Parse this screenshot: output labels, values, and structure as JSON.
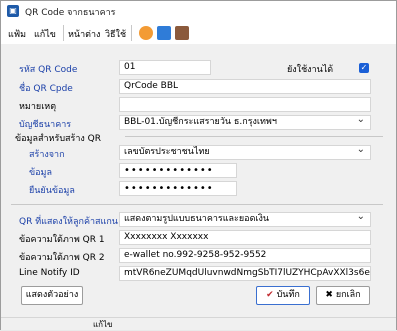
{
  "window": {
    "title": "QR Code จากธนาคาร",
    "icon": "qr-app-icon"
  },
  "menu": {
    "file": "แฟ้ม",
    "edit": "แก้ไข",
    "window": "หน้าต่าง",
    "method": "วิธีใช้"
  },
  "form": {
    "qr_code_label": "รหัส QR Code",
    "qr_code_value": "01",
    "inactive_label": "ยังใช้งานได้",
    "qr_name_label": "ชื่อ QR Cpde",
    "qr_name_value": "QrCode BBL",
    "note_label": "หมายเหตุ",
    "note_value": "",
    "bank_account_label": "บัญชีธนาคาร",
    "bank_account_value": "BBL-01.บัญชีกระแสรายวัน ธ.กรุงเทพฯ",
    "group_title": "ข้อมูลสำหรับสร้าง QR",
    "create_from_label": "สร้างจาก",
    "create_from_value": "เลขบัตรประชาชนไทย",
    "data_label": "ข้อมูล",
    "data_value": "•••••••••••••",
    "confirm_label": "ยืนยันข้อมูล",
    "confirm_value": "•••••••••••••",
    "qr_display_label": "QR ที่แสดงให้ลูกค้าสแกน",
    "qr_display_value": "แสดงตามรูปแบบธนาคารและยอดเงิน",
    "caption1_label": "ข้อความใต้ภาพ QR 1",
    "caption1_value": "Xxxxxxxx Xxxxxxx",
    "caption2_label": "ข้อความใต้ภาพ QR 2",
    "caption2_value": "e-wallet no.992-9258-952-9552",
    "line_notify_label": "Line Notify ID",
    "line_notify_value": "mtVR6neZUMqdUluvnwdNmgSbTI7lUZYHCpAvXXl3s6e"
  },
  "buttons": {
    "preview": "แสดงตัวอย่าง",
    "save": "บันทึก",
    "cancel": "ยกเลิก"
  },
  "status": {
    "mode": "แก้ไข"
  },
  "colors": {
    "label_blue": "#1a3fa8",
    "checkbox": "#1a5fd6",
    "save_icon": "#c0282d"
  }
}
